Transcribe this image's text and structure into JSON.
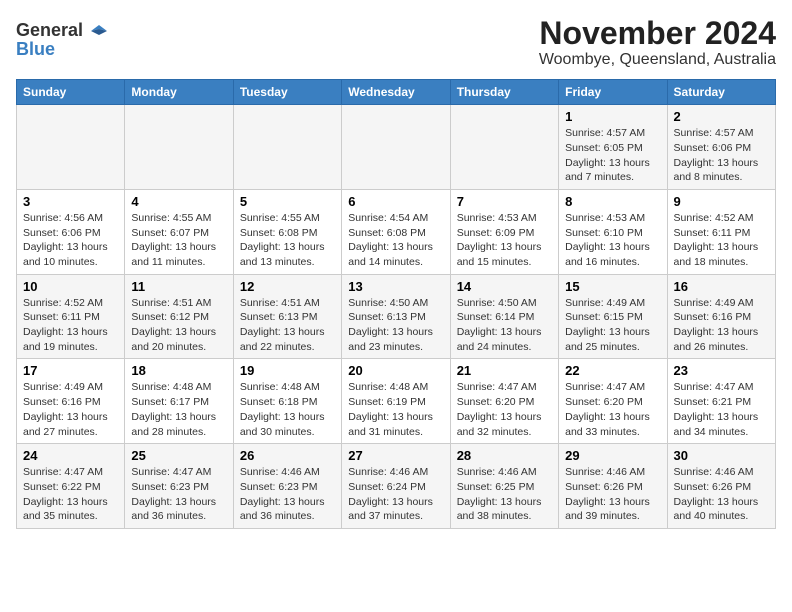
{
  "logo": {
    "general": "General",
    "blue": "Blue"
  },
  "title": "November 2024",
  "subtitle": "Woombye, Queensland, Australia",
  "weekdays": [
    "Sunday",
    "Monday",
    "Tuesday",
    "Wednesday",
    "Thursday",
    "Friday",
    "Saturday"
  ],
  "weeks": [
    [
      {
        "day": "",
        "info": ""
      },
      {
        "day": "",
        "info": ""
      },
      {
        "day": "",
        "info": ""
      },
      {
        "day": "",
        "info": ""
      },
      {
        "day": "",
        "info": ""
      },
      {
        "day": "1",
        "info": "Sunrise: 4:57 AM\nSunset: 6:05 PM\nDaylight: 13 hours and 7 minutes."
      },
      {
        "day": "2",
        "info": "Sunrise: 4:57 AM\nSunset: 6:06 PM\nDaylight: 13 hours and 8 minutes."
      }
    ],
    [
      {
        "day": "3",
        "info": "Sunrise: 4:56 AM\nSunset: 6:06 PM\nDaylight: 13 hours and 10 minutes."
      },
      {
        "day": "4",
        "info": "Sunrise: 4:55 AM\nSunset: 6:07 PM\nDaylight: 13 hours and 11 minutes."
      },
      {
        "day": "5",
        "info": "Sunrise: 4:55 AM\nSunset: 6:08 PM\nDaylight: 13 hours and 13 minutes."
      },
      {
        "day": "6",
        "info": "Sunrise: 4:54 AM\nSunset: 6:08 PM\nDaylight: 13 hours and 14 minutes."
      },
      {
        "day": "7",
        "info": "Sunrise: 4:53 AM\nSunset: 6:09 PM\nDaylight: 13 hours and 15 minutes."
      },
      {
        "day": "8",
        "info": "Sunrise: 4:53 AM\nSunset: 6:10 PM\nDaylight: 13 hours and 16 minutes."
      },
      {
        "day": "9",
        "info": "Sunrise: 4:52 AM\nSunset: 6:11 PM\nDaylight: 13 hours and 18 minutes."
      }
    ],
    [
      {
        "day": "10",
        "info": "Sunrise: 4:52 AM\nSunset: 6:11 PM\nDaylight: 13 hours and 19 minutes."
      },
      {
        "day": "11",
        "info": "Sunrise: 4:51 AM\nSunset: 6:12 PM\nDaylight: 13 hours and 20 minutes."
      },
      {
        "day": "12",
        "info": "Sunrise: 4:51 AM\nSunset: 6:13 PM\nDaylight: 13 hours and 22 minutes."
      },
      {
        "day": "13",
        "info": "Sunrise: 4:50 AM\nSunset: 6:13 PM\nDaylight: 13 hours and 23 minutes."
      },
      {
        "day": "14",
        "info": "Sunrise: 4:50 AM\nSunset: 6:14 PM\nDaylight: 13 hours and 24 minutes."
      },
      {
        "day": "15",
        "info": "Sunrise: 4:49 AM\nSunset: 6:15 PM\nDaylight: 13 hours and 25 minutes."
      },
      {
        "day": "16",
        "info": "Sunrise: 4:49 AM\nSunset: 6:16 PM\nDaylight: 13 hours and 26 minutes."
      }
    ],
    [
      {
        "day": "17",
        "info": "Sunrise: 4:49 AM\nSunset: 6:16 PM\nDaylight: 13 hours and 27 minutes."
      },
      {
        "day": "18",
        "info": "Sunrise: 4:48 AM\nSunset: 6:17 PM\nDaylight: 13 hours and 28 minutes."
      },
      {
        "day": "19",
        "info": "Sunrise: 4:48 AM\nSunset: 6:18 PM\nDaylight: 13 hours and 30 minutes."
      },
      {
        "day": "20",
        "info": "Sunrise: 4:48 AM\nSunset: 6:19 PM\nDaylight: 13 hours and 31 minutes."
      },
      {
        "day": "21",
        "info": "Sunrise: 4:47 AM\nSunset: 6:20 PM\nDaylight: 13 hours and 32 minutes."
      },
      {
        "day": "22",
        "info": "Sunrise: 4:47 AM\nSunset: 6:20 PM\nDaylight: 13 hours and 33 minutes."
      },
      {
        "day": "23",
        "info": "Sunrise: 4:47 AM\nSunset: 6:21 PM\nDaylight: 13 hours and 34 minutes."
      }
    ],
    [
      {
        "day": "24",
        "info": "Sunrise: 4:47 AM\nSunset: 6:22 PM\nDaylight: 13 hours and 35 minutes."
      },
      {
        "day": "25",
        "info": "Sunrise: 4:47 AM\nSunset: 6:23 PM\nDaylight: 13 hours and 36 minutes."
      },
      {
        "day": "26",
        "info": "Sunrise: 4:46 AM\nSunset: 6:23 PM\nDaylight: 13 hours and 36 minutes."
      },
      {
        "day": "27",
        "info": "Sunrise: 4:46 AM\nSunset: 6:24 PM\nDaylight: 13 hours and 37 minutes."
      },
      {
        "day": "28",
        "info": "Sunrise: 4:46 AM\nSunset: 6:25 PM\nDaylight: 13 hours and 38 minutes."
      },
      {
        "day": "29",
        "info": "Sunrise: 4:46 AM\nSunset: 6:26 PM\nDaylight: 13 hours and 39 minutes."
      },
      {
        "day": "30",
        "info": "Sunrise: 4:46 AM\nSunset: 6:26 PM\nDaylight: 13 hours and 40 minutes."
      }
    ]
  ]
}
